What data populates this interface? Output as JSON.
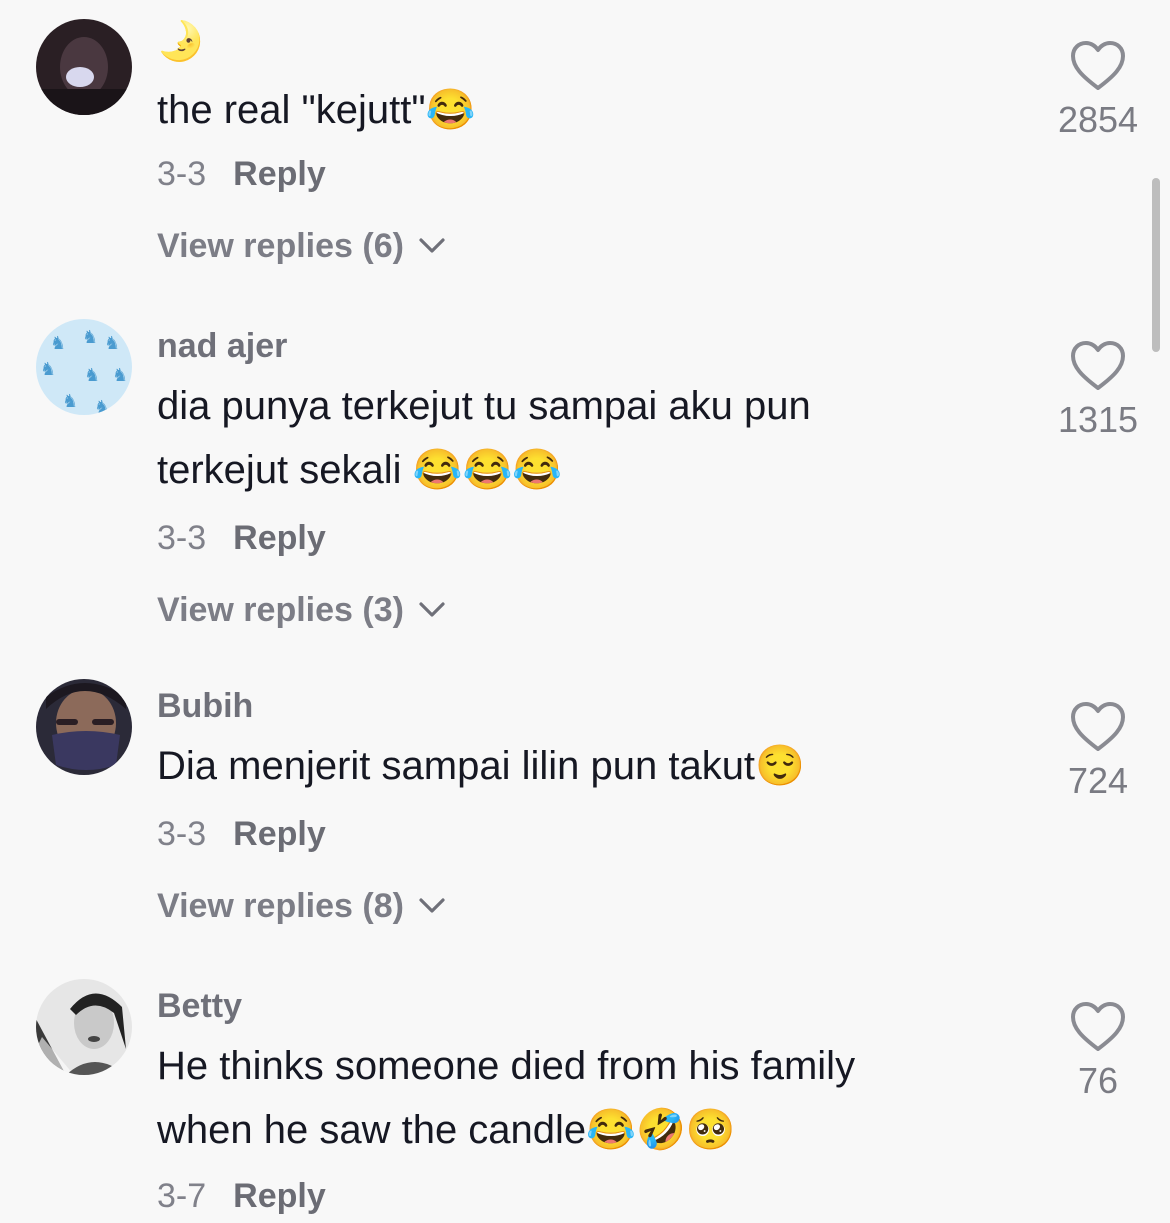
{
  "comments": [
    {
      "username": "🌛",
      "text": "the real \"kejutt\"😂",
      "date": "3-3",
      "reply_label": "Reply",
      "view_replies": "View replies (6)",
      "likes": "2854"
    },
    {
      "username": "nad ajer",
      "text": "dia punya terkejut tu sampai aku pun terkejut sekali 😂😂😂",
      "date": "3-3",
      "reply_label": "Reply",
      "view_replies": "View replies (3)",
      "likes": "1315"
    },
    {
      "username": "Bubih",
      "text": "Dia menjerit sampai lilin pun takut😌",
      "date": "3-3",
      "reply_label": "Reply",
      "view_replies": "View replies (8)",
      "likes": "724"
    },
    {
      "username": "Betty",
      "text": "He thinks someone died from his family when he saw the candle😂🤣🥺",
      "date": "3-7",
      "reply_label": "Reply",
      "likes": "76"
    }
  ],
  "icons": {
    "like": "heart-outline-icon",
    "expand": "chevron-down-icon"
  },
  "colors": {
    "background": "#f8f8f8",
    "text": "#161823",
    "secondary_text": "#75767e"
  }
}
